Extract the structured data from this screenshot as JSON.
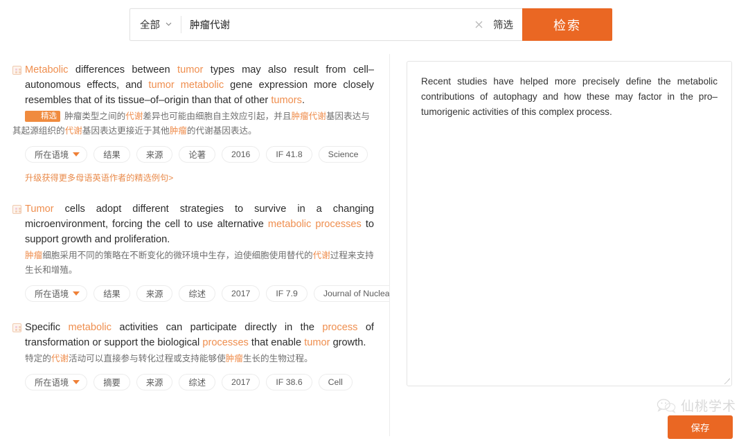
{
  "search": {
    "scope_label": "全部",
    "scope_icon": "chevron-down-icon",
    "query_value": "肿瘤代谢",
    "query_placeholder": "",
    "clear_icon": "close-icon",
    "filter_label": "筛选",
    "search_button_label": "检索",
    "accent_color": "#ea6723"
  },
  "results": [
    {
      "icon": "quote-icon",
      "en_parts": [
        {
          "t": "Metabolic",
          "kw": true
        },
        {
          "t": " differences between ",
          "kw": false
        },
        {
          "t": "tumor",
          "kw": true
        },
        {
          "t": " types may also result from cell–autonomous effects, and ",
          "kw": false
        },
        {
          "t": "tumor metabolic",
          "kw": true
        },
        {
          "t": " gene expression more closely resembles that of its tissue–of–origin than that of other ",
          "kw": false
        },
        {
          "t": "tumors",
          "kw": true
        },
        {
          "t": ".",
          "kw": false
        }
      ],
      "badge": "精选",
      "cn_parts": [
        {
          "t": "肿瘤类型之间的",
          "kw": false
        },
        {
          "t": "代谢",
          "kw": true
        },
        {
          "t": "差异也可能由细胞自主效应引起，并且",
          "kw": false
        },
        {
          "t": "肿瘤代谢",
          "kw": true
        },
        {
          "t": "基因表达与其起源组织的",
          "kw": false
        },
        {
          "t": "代谢",
          "kw": true
        },
        {
          "t": "基因表达更接近于其他",
          "kw": false
        },
        {
          "t": "肿瘤",
          "kw": true
        },
        {
          "t": "的代谢基因表达。",
          "kw": false
        }
      ],
      "tags": [
        "所在语境",
        "结果",
        "来源",
        "论著",
        "2016",
        "IF 41.8",
        "Science"
      ],
      "upgrade_link": "升级获得更多母语英语作者的精选例句>"
    },
    {
      "icon": "quote-icon",
      "en_parts": [
        {
          "t": "Tumor",
          "kw": true
        },
        {
          "t": " cells adopt different strategies to survive in a changing microenvironment, forcing the cell to use alternative ",
          "kw": false
        },
        {
          "t": "metabolic processes",
          "kw": true
        },
        {
          "t": " to support growth and proliferation.",
          "kw": false
        }
      ],
      "badge": "",
      "cn_parts": [
        {
          "t": "肿瘤",
          "kw": true
        },
        {
          "t": "细胞采用不同的策略在不断变化的微环境中生存，迫使细胞使用替代的",
          "kw": false
        },
        {
          "t": "代谢",
          "kw": true
        },
        {
          "t": "过程来支持生长和增殖。",
          "kw": false
        }
      ],
      "tags": [
        "所在语境",
        "结果",
        "来源",
        "综述",
        "2017",
        "IF 7.9",
        "Journal of Nuclea..."
      ],
      "upgrade_link": ""
    },
    {
      "icon": "quote-icon",
      "en_parts": [
        {
          "t": "Specific ",
          "kw": false
        },
        {
          "t": "metabolic",
          "kw": true
        },
        {
          "t": " activities can participate directly in the ",
          "kw": false
        },
        {
          "t": "process",
          "kw": true
        },
        {
          "t": " of transformation or support the biological ",
          "kw": false
        },
        {
          "t": "processes",
          "kw": true
        },
        {
          "t": " that enable ",
          "kw": false
        },
        {
          "t": "tumor",
          "kw": true
        },
        {
          "t": " growth.",
          "kw": false
        }
      ],
      "badge": "",
      "cn_parts": [
        {
          "t": "特定的",
          "kw": false
        },
        {
          "t": "代谢",
          "kw": true
        },
        {
          "t": "活动可以直接参与转化过程或支持能够使",
          "kw": false
        },
        {
          "t": "肿瘤",
          "kw": true
        },
        {
          "t": "生长的生物过程。",
          "kw": false
        }
      ],
      "tags": [
        "所在语境",
        "摘要",
        "来源",
        "综述",
        "2017",
        "IF 38.6",
        "Cell"
      ],
      "upgrade_link": ""
    }
  ],
  "notepad": {
    "text": "Recent studies have helped more precisely define the metabolic contributions of autophagy and how these may factor in the pro–tumorigenic activities of this complex process.",
    "resize_handle": "resize-handle"
  },
  "watermark": {
    "text": "仙桃学术",
    "icon": "wechat-icon"
  },
  "footer": {
    "save_label": "保存"
  }
}
